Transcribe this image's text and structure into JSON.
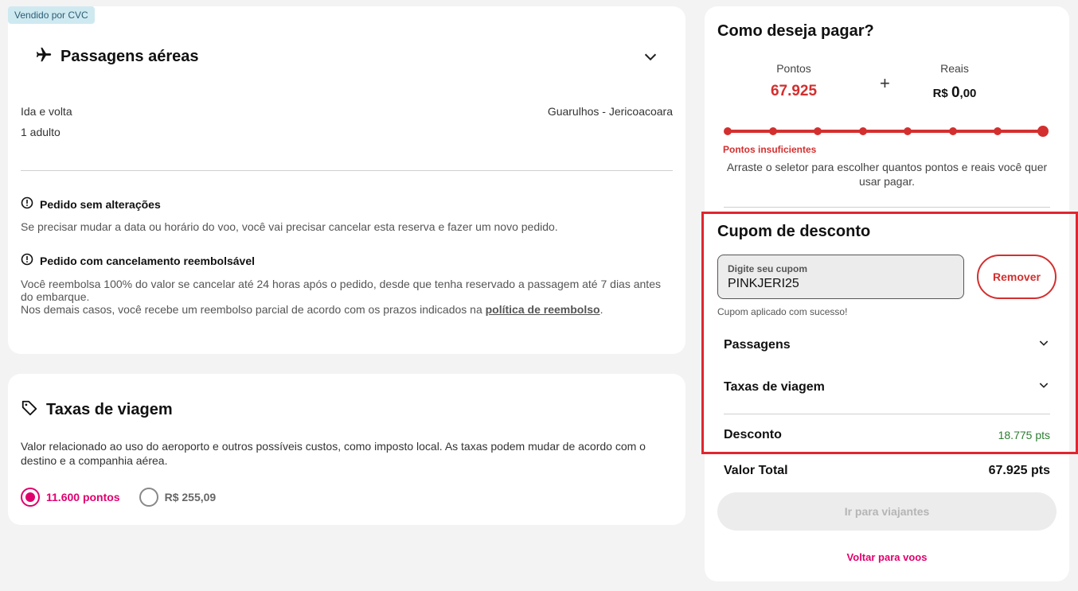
{
  "badge": "Vendido por CVC",
  "flights": {
    "title": "Passagens aéreas",
    "trip_type": "Ida e volta",
    "passengers": "1 adulto",
    "route": "Guarulhos - Jericoacoara",
    "notice1_title": "Pedido sem alterações",
    "notice1_text": "Se precisar mudar a data ou horário do voo, você vai precisar cancelar esta reserva e fazer um novo pedido.",
    "notice2_title": "Pedido com cancelamento reembolsável",
    "notice2_line1": "Você reembolsa 100% do valor se cancelar até 24 horas após o pedido, desde que tenha reservado a passagem até 7 dias antes do embarque.",
    "notice2_line2": "Nos demais casos, você recebe um reembolso parcial de acordo com os prazos indicados na ",
    "notice2_link": "política de reembolso",
    "notice2_end": "."
  },
  "taxes": {
    "title": "Taxas de viagem",
    "description": "Valor relacionado ao uso do aeroporto e outros possíveis custos, como imposto local. As taxas podem mudar de acordo com o destino e a companhia aérea.",
    "option_points": "11.600 pontos",
    "option_reais": "R$ 255,09",
    "selected": "points"
  },
  "payment": {
    "title": "Como deseja pagar?",
    "points_label": "Pontos",
    "points_value": "67.925",
    "reais_label": "Reais",
    "reais_prefix": "R$",
    "reais_int": "0",
    "reais_dec": ",00",
    "plus": "+",
    "slider_level": 1.0,
    "warning": "Pontos insuficientes",
    "hint": "Arraste o seletor para escolher quantos pontos e reais você quer usar pagar.",
    "accent": "#d32f2f"
  },
  "coupon": {
    "title": "Cupom de desconto",
    "input_label": "Digite seu cupom",
    "input_value": "PINKJERI25",
    "remove_label": "Remover",
    "success": "Cupom aplicado com sucesso!",
    "rows": [
      "Passagens",
      "Taxas de viagem"
    ],
    "discount_label": "Desconto",
    "discount_value": "18.775 pts"
  },
  "total": {
    "label": "Valor Total",
    "value": "67.925 pts"
  },
  "cta_label": "Ir para viajantes",
  "back_label": "Voltar para voos",
  "colors": {
    "brand_pink": "#e0006d",
    "error_red": "#d32f2f",
    "success_green": "#2e7d32"
  }
}
